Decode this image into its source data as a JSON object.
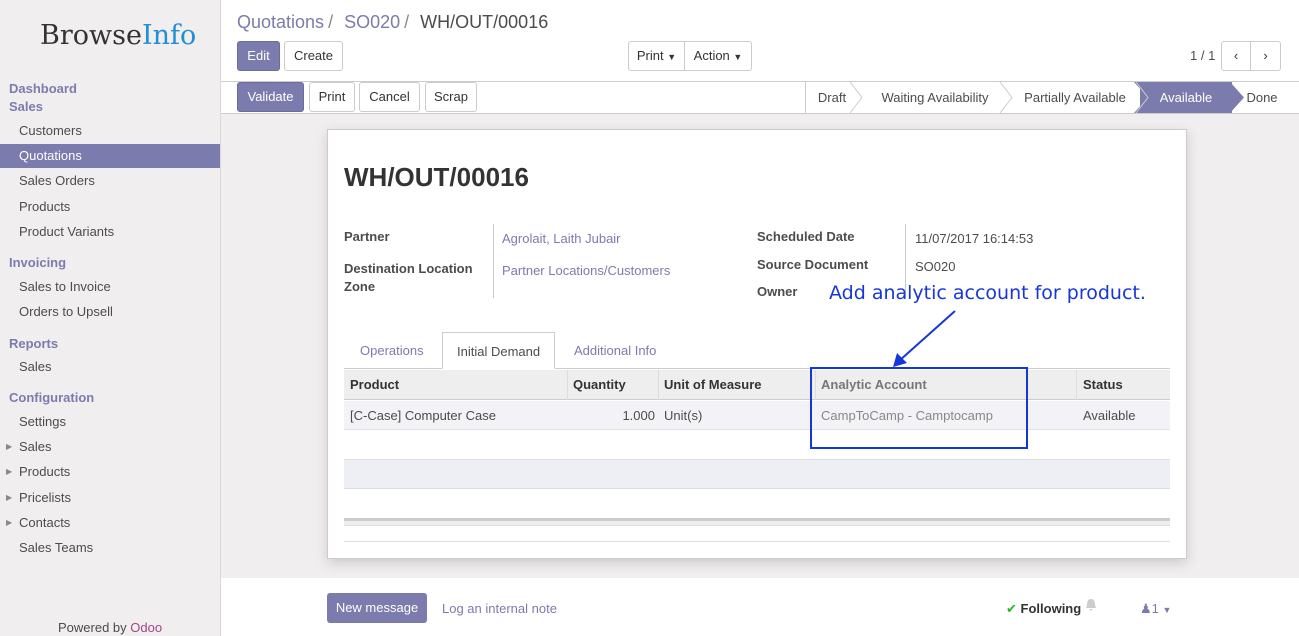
{
  "app": {
    "logo_main": "Browse",
    "logo_accent": "Info",
    "powered_by": "Powered by",
    "powered_brand": "Odoo"
  },
  "sidebar": {
    "sections": [
      {
        "title": "Dashboard"
      },
      {
        "title": "Sales",
        "items": [
          "Customers",
          "Quotations",
          "Sales Orders",
          "Products",
          "Product Variants"
        ]
      },
      {
        "title": "Invoicing",
        "items": [
          "Sales to Invoice",
          "Orders to Upsell"
        ]
      },
      {
        "title": "Reports",
        "items": [
          "Sales"
        ]
      },
      {
        "title": "Configuration",
        "items": [
          "Settings",
          "Sales",
          "Products",
          "Pricelists",
          "Contacts",
          "Sales Teams"
        ]
      }
    ],
    "active_item": "Quotations"
  },
  "breadcrumb": {
    "level1": "Quotations",
    "level2": "SO020",
    "current": "WH/OUT/00016"
  },
  "toolbar": {
    "edit": "Edit",
    "create": "Create",
    "print": "Print",
    "action": "Action",
    "pager": "1 / 1"
  },
  "statusbar": {
    "buttons": {
      "validate": "Validate",
      "print": "Print",
      "cancel": "Cancel",
      "scrap": "Scrap"
    },
    "stages": [
      "Draft",
      "Waiting Availability",
      "Partially Available",
      "Available",
      "Done"
    ],
    "active_stage": "Available"
  },
  "form": {
    "title": "WH/OUT/00016",
    "partner_label": "Partner",
    "partner_value": "Agrolait, Laith Jubair",
    "dest_label_1": "Destination Location",
    "dest_label_2": "Zone",
    "dest_value": "Partner Locations/Customers",
    "scheduled_label": "Scheduled Date",
    "scheduled_value": "11/07/2017 16:14:53",
    "source_label": "Source Document",
    "source_value": "SO020",
    "owner_label": "Owner"
  },
  "tabs": [
    "Operations",
    "Initial Demand",
    "Additional Info"
  ],
  "active_tab": "Initial Demand",
  "table": {
    "columns": [
      "Product",
      "Quantity",
      "Unit of Measure",
      "Analytic Account",
      "Status"
    ],
    "rows": [
      [
        "[C-Case] Computer Case",
        "1.000",
        "Unit(s)",
        "CampToCamp - Camptocamp",
        "Available"
      ]
    ]
  },
  "annotation": {
    "text": "Add analytic account for product.",
    "color": "#1636d6"
  },
  "chatter": {
    "new_message": "New message",
    "log_note": "Log an internal note",
    "following": "Following",
    "followers_count": "1"
  },
  "colors": {
    "brand": "#7c7bad",
    "sidebar_bg": "#f0eeee",
    "logo_accent": "#1f8fd8"
  }
}
